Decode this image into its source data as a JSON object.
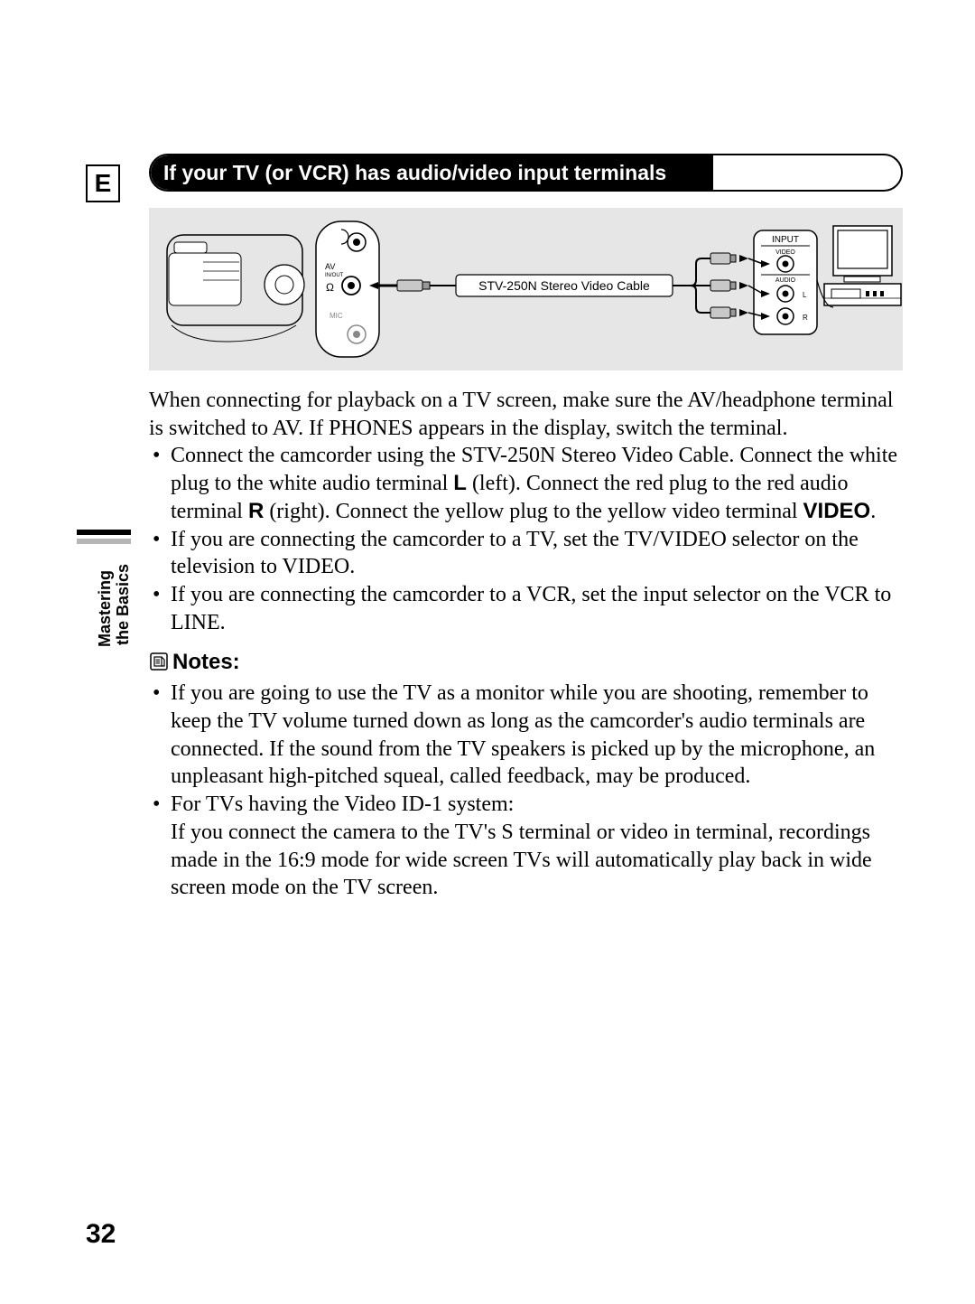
{
  "lang_marker": "E",
  "section_header": "If your TV (or VCR) has audio/video input terminals",
  "diagram": {
    "cable_label": "STV-250N Stereo Video Cable",
    "camcorder_port_top": "AV",
    "camcorder_port_top2": "IN/OUT",
    "camcorder_port_mid": "Ω",
    "camcorder_port_bottom": "MIC",
    "tv_input_title": "INPUT",
    "tv_video": "VIDEO",
    "tv_audio": "AUDIO",
    "tv_l": "L",
    "tv_r": "R"
  },
  "intro_p1": "When connecting for playback on a TV screen, make sure the AV/headphone terminal is switched to AV. If PHONES appears in the display, switch the terminal.",
  "bullets": [
    {
      "pre": "Connect the camcorder using the STV-250N Stereo Video Cable. Connect the white plug to the white audio terminal ",
      "b1": "L",
      "mid1": " (left). Connect the red plug to the red audio terminal ",
      "b2": "R",
      "mid2": " (right). Connect the yellow plug to the yellow video terminal ",
      "b3": "VIDEO",
      "post": "."
    },
    {
      "text": "If you are connecting the camcorder to a TV, set the TV/VIDEO selector on the television to VIDEO."
    },
    {
      "text": "If you are connecting the camcorder to a VCR, set the input selector on the VCR to LINE."
    }
  ],
  "notes_heading": "Notes:",
  "notes": [
    "If you are going to use the TV as a monitor while you are shooting, remember to keep the TV volume turned down as long as the camcorder's audio terminals are connected. If the sound from the TV speakers is picked up by the microphone, an unpleasant high-pitched squeal, called feedback, may be produced.",
    "For TVs having the Video ID-1 system:\nIf you connect the camera to the TV's S terminal or video in terminal, recordings made in the 16:9 mode for wide screen TVs will automatically play back in wide screen mode on the TV screen."
  ],
  "side_label_line1": "Mastering",
  "side_label_line2": "the Basics",
  "page_number": "32"
}
